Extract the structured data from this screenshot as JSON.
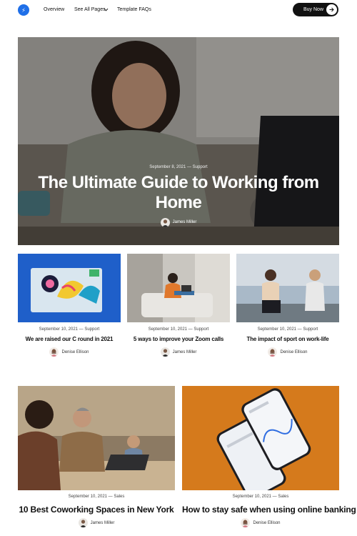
{
  "nav": {
    "links": [
      "Overview",
      "See All Pages",
      "Template FAQs"
    ],
    "cta": "Buy Now",
    "logo_icon": "s-logo-icon",
    "dropdown_icon": "chevron-down-icon",
    "cta_icon": "arrow-right-icon",
    "brand_color": "#1f6fe8"
  },
  "hero": {
    "meta": "September 8, 2021 — Support",
    "title": "The Ultimate Guide to Working from Home",
    "author": "James Miller"
  },
  "posts_row1": [
    {
      "meta": "September 10, 2021 — Support",
      "title": "We are raised our C round in 2021",
      "author": "Denise Ellison"
    },
    {
      "meta": "September 10, 2021 — Support",
      "title": "5 ways to improve your Zoom calls",
      "author": "James Miller"
    },
    {
      "meta": "September 10, 2021 — Support",
      "title": "The impact of sport on work-life",
      "author": "Denise Ellison"
    }
  ],
  "posts_row2": [
    {
      "meta": "September 10, 2021 — Sales",
      "title": "10 Best Coworking Spaces in New York",
      "author": "James Miller"
    },
    {
      "meta": "September 10, 2021 — Sales",
      "title": "How to stay safe when using online banking",
      "author": "Denise Ellison"
    }
  ]
}
